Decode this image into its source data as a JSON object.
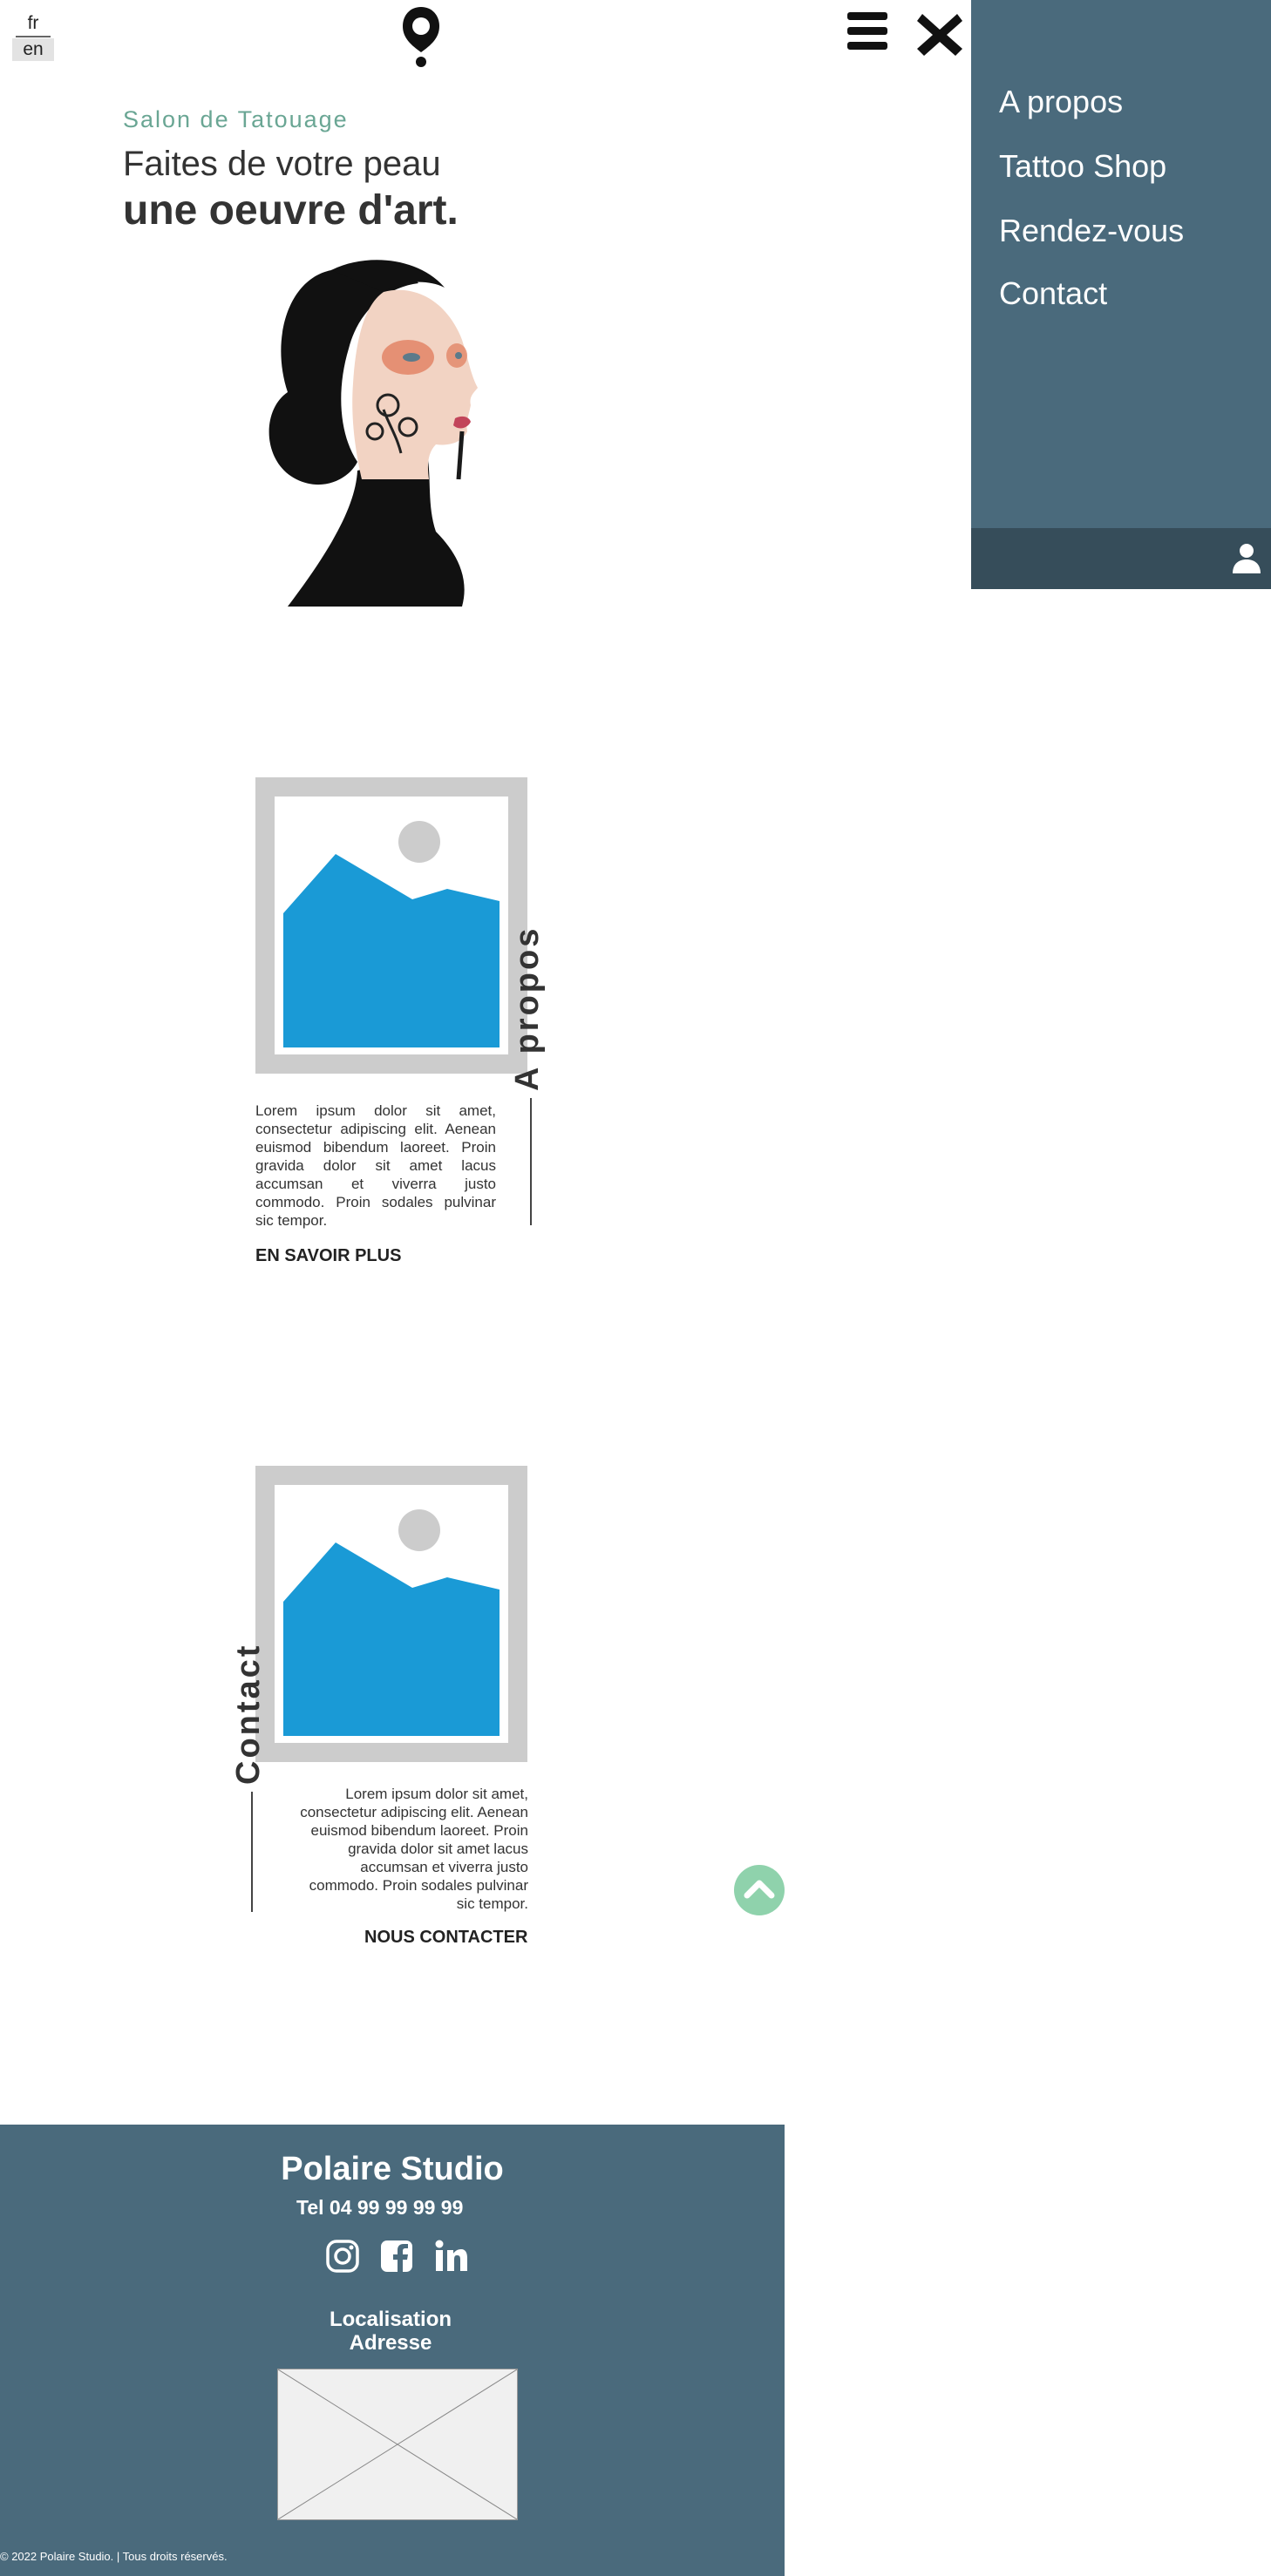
{
  "language_switch": {
    "options": [
      "fr",
      "en"
    ],
    "active": "en"
  },
  "side_menu": {
    "items": [
      "A propos",
      "Tattoo Shop",
      "Rendez-vous",
      "Contact"
    ]
  },
  "hero": {
    "subtitle": "Salon de Tatouage",
    "headline_line1": "Faites de votre peau",
    "headline_line2": "une oeuvre d'art."
  },
  "about": {
    "title": "A propos",
    "text": "Lorem ipsum dolor sit amet, consectetur adipiscing elit. Aenean euismod bibendum laoreet. Proin gravida dolor sit amet lacus accumsan et viverra justo commodo. Proin sodales pulvinar sic tempor.",
    "cta": "EN SAVOIR PLUS"
  },
  "contact": {
    "title": "Contact",
    "text": "Lorem ipsum dolor sit amet, consectetur adipiscing elit. Aenean euismod bibendum laoreet. Proin gravida dolor sit amet lacus accumsan et viverra justo commodo. Proin sodales pulvinar sic tempor.",
    "cta": "NOUS CONTACTER"
  },
  "footer": {
    "title": "Polaire Studio",
    "tel": "Tel 04 99 99 99 99",
    "localisation": "Localisation",
    "address": "Adresse",
    "copyright": "© 2022 Polaire Studio. | Tous droits réservés.",
    "social_icons": [
      "instagram-icon",
      "facebook-icon",
      "linkedin-icon"
    ]
  },
  "colors": {
    "menu_bg": "#4a6a7c",
    "menu_bottom": "#364d5a",
    "accent_green": "#6aa694",
    "back_to_top": "#8fd2ac",
    "placeholder_blue": "#1a9ad6"
  }
}
